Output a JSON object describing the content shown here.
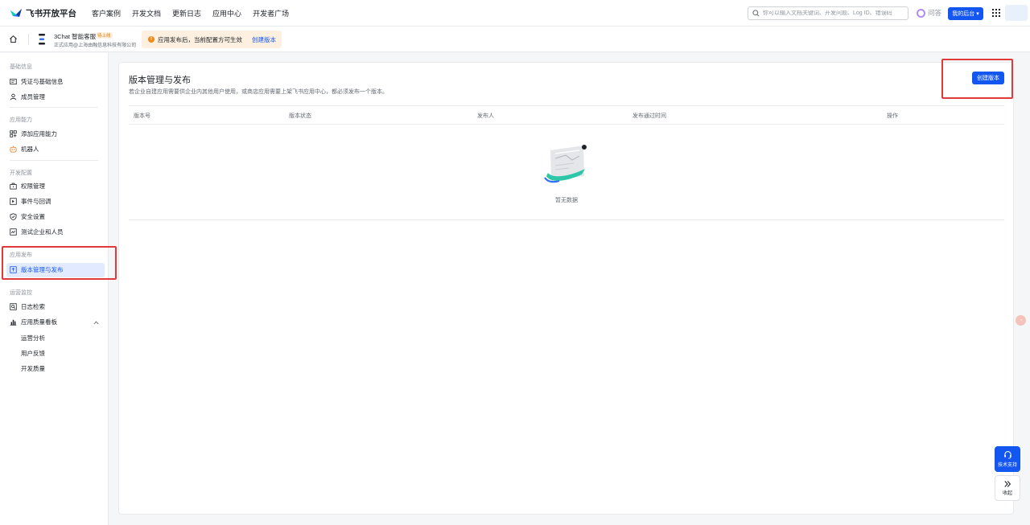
{
  "topbar": {
    "brand": "飞书开放平台",
    "nav": [
      "客户案例",
      "开发文档",
      "更新日志",
      "应用中心",
      "开发者广场"
    ],
    "search_placeholder": "你可以输入文档关键词、开发问题、Log ID、错误码",
    "wenda": "问答",
    "backend_button": "我的后台 ▾"
  },
  "app": {
    "name": "3Chat 智能客服",
    "badge": "待上线",
    "subtitle": "正式应用@上海由融信息科技有限公司",
    "notice_text": "应用发布后，当前配置方可生效",
    "notice_link": "创建版本"
  },
  "sidebar": {
    "basic_title": "基础信息",
    "credentials": "凭证与基础信息",
    "members": "成员管理",
    "ability_title": "应用能力",
    "add_ability": "添加应用能力",
    "bot": "机器人",
    "dev_title": "开发配置",
    "permissions": "权限管理",
    "events": "事件与回调",
    "security": "安全设置",
    "test_users": "测试企业和人员",
    "publish_title": "应用发布",
    "version_mgmt": "版本管理与发布",
    "ops_title": "运营监控",
    "log_search": "日志检索",
    "quality_board": "应用质量看板",
    "ops_analysis": "运营分析",
    "user_feedback": "用户反馈",
    "dev_quality": "开发质量"
  },
  "main": {
    "title": "版本管理与发布",
    "description": "若企业自建应用需要供企业内其他用户使用，或商店应用需要上架飞书应用中心，都必须发布一个版本。",
    "create_button": "创建版本",
    "columns": [
      "版本号",
      "版本状态",
      "发布人",
      "发布通过时间",
      "操作"
    ],
    "empty_text": "暂无数据"
  },
  "floating": {
    "support": "技术支持",
    "collapse": "收起"
  },
  "colors": {
    "primary": "#1456f0",
    "annotation": "#e03a3a",
    "active_bg": "#e1eaff"
  }
}
